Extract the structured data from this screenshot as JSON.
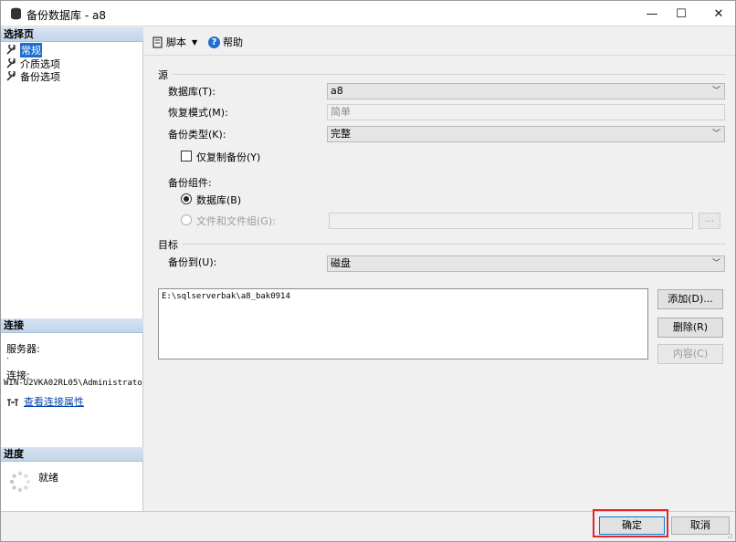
{
  "window": {
    "title": "备份数据库 - a8",
    "controls": {
      "minimize": "—",
      "maximize": "☐",
      "close": "✕"
    }
  },
  "left_panel": {
    "select_page_header": "选择页",
    "pages": [
      {
        "label": "常规",
        "selected": true
      },
      {
        "label": "介质选项",
        "selected": false
      },
      {
        "label": "备份选项",
        "selected": false
      }
    ],
    "connection_header": "连接",
    "server_label": "服务器:",
    "server_value": ".",
    "connection_label": "连接:",
    "connection_value": "WIN-U2VKA02RL05\\Administrato",
    "view_props_link": "查看连接属性",
    "progress_header": "进度",
    "progress_status": "就绪"
  },
  "toolbar": {
    "script_label": "脚本",
    "help_label": "帮助"
  },
  "source": {
    "group_label": "源",
    "database_label": "数据库(T):",
    "database_value": "a8",
    "recovery_label": "恢复模式(M):",
    "recovery_value": "简单",
    "backup_type_label": "备份类型(K):",
    "backup_type_value": "完整",
    "copy_only_label": "仅复制备份(Y)",
    "component_label": "备份组件:",
    "component_database": "数据库(B)",
    "component_files": "文件和文件组(G):",
    "files_button": "..."
  },
  "destination": {
    "group_label": "目标",
    "backup_to_label": "备份到(U):",
    "backup_to_value": "磁盘",
    "paths": [
      "E:\\sqlserverbak\\a8_bak0914"
    ],
    "add_button": "添加(D)...",
    "remove_button": "删除(R)",
    "contents_button": "内容(C)"
  },
  "footer": {
    "ok_button": "确定",
    "cancel_button": "取消"
  },
  "colors": {
    "selection": "#1c6fd1",
    "highlight_box": "#e0282a",
    "help_icon": "#1f6fd1",
    "link": "#0645ad"
  }
}
